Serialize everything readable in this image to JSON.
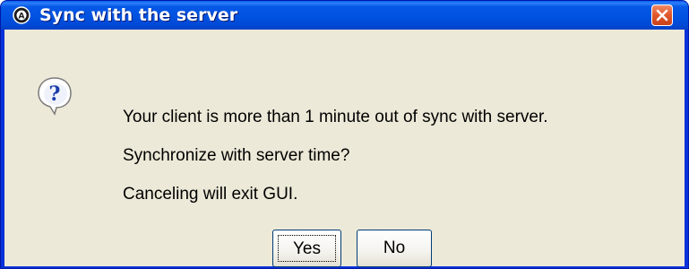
{
  "window": {
    "title": "Sync with the server",
    "app_icon": "app-logo-icon",
    "close_icon": "close-icon"
  },
  "dialog": {
    "icon": "question-icon",
    "messages": [
      "Your client is more than 1 minute out of sync with server.",
      "Synchronize with server time?",
      "Canceling will exit GUI."
    ],
    "buttons": {
      "yes_label": "Yes",
      "no_label": "No"
    }
  },
  "colors": {
    "titlebar": "#0052e0",
    "close_button": "#e35a2d",
    "client_background": "#ece9d8",
    "icon_blue": "#1a3ca8"
  }
}
